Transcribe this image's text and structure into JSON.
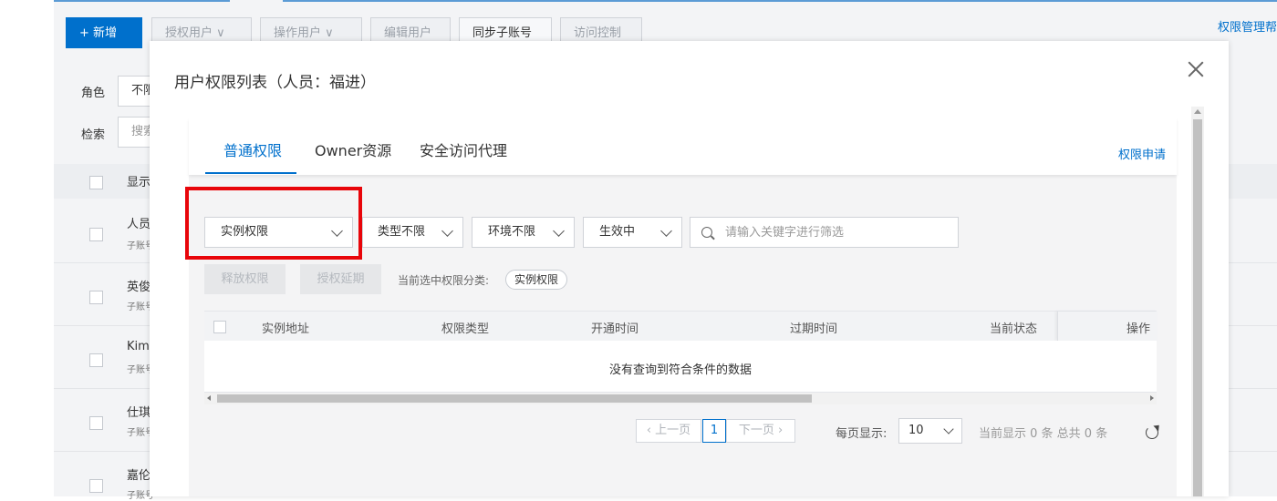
{
  "background": {
    "add_button": "+ 新增",
    "toolbar_buttons": [
      "授权用户 ∨",
      "操作用户 ∨",
      "编辑用户",
      "同步子账号",
      "访问控制"
    ],
    "help_link": "权限管理帮",
    "role_label": "角色",
    "role_value": "不限",
    "search_label": "检索",
    "search_value": "搜索",
    "table_header": "显示",
    "rows": [
      {
        "name": "人员",
        "sub": "子账号"
      },
      {
        "name": "英俊",
        "sub": "子账号"
      },
      {
        "name": "Kim",
        "sub": "子账号"
      },
      {
        "name": "仕琪",
        "sub": "子账号"
      },
      {
        "name": "嘉伦",
        "sub": "子账号"
      }
    ]
  },
  "modal": {
    "title": "用户权限列表（人员：福进）",
    "tabs": [
      {
        "label": "普通权限",
        "active": true
      },
      {
        "label": "Owner资源",
        "active": false
      },
      {
        "label": "安全访问代理",
        "active": false
      }
    ],
    "apply_link": "权限申请",
    "filters": {
      "permission_scope": "实例权限",
      "type": "类型不限",
      "environment": "环境不限",
      "status": "生效中",
      "search_placeholder": "请输入关键字进行筛选"
    },
    "actions": {
      "release": "释放权限",
      "extend": "授权延期"
    },
    "current_category_label": "当前选中权限分类:",
    "current_category_tag": "实例权限",
    "table": {
      "columns": [
        "实例地址",
        "权限类型",
        "开通时间",
        "过期时间",
        "当前状态",
        "操作"
      ],
      "empty_text": "没有查询到符合条件的数据"
    },
    "pagination": {
      "prev": "上一页",
      "page": "1",
      "next": "下一页",
      "page_size_label": "每页显示:",
      "page_size": "10",
      "summary": "当前显示 0 条 总共 0 条"
    }
  },
  "colors": {
    "primary": "#0070cc",
    "highlight": "#e8050a"
  }
}
